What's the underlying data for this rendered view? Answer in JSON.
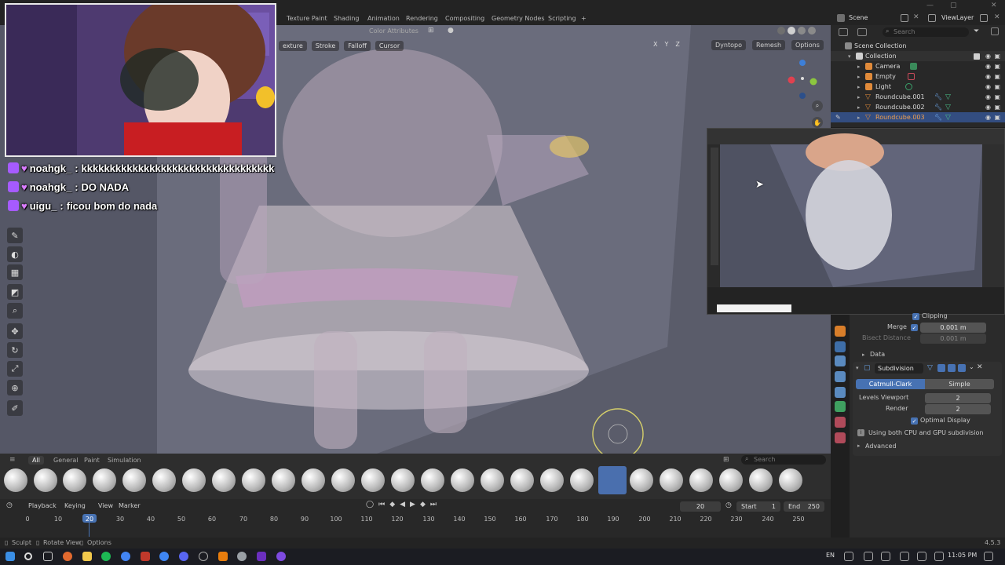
{
  "topbar": {
    "tabs": [
      "Texture Paint",
      "Shading",
      "Animation",
      "Rendering",
      "Compositing",
      "Geometry Nodes",
      "Scripting",
      "+"
    ],
    "scene_label": "Scene",
    "viewlayer_label": "ViewLayer"
  },
  "viewport": {
    "header_left": [
      "exture",
      "Stroke",
      "Falloff",
      "Cursor"
    ],
    "color_attributes": "Color Attributes",
    "axes": [
      "X",
      "Y",
      "Z"
    ],
    "dyntopo": "Dyntopo",
    "remesh": "Remesh",
    "options": "Options"
  },
  "chat": [
    {
      "user": "noahgk_",
      "message": "kkkkkkkkkkkkkkkkkkkkkkkkkkkkkkkkkk",
      "icon": "heart-icon"
    },
    {
      "user": "noahgk_",
      "message": "DO NADA",
      "icon": "heart-icon"
    },
    {
      "user": "uigu_",
      "message": "ficou bom do nada",
      "icon": "heart-icon"
    }
  ],
  "outliner": {
    "search_placeholder": "Search",
    "scene_collection": "Scene Collection",
    "items": [
      {
        "name": "Collection",
        "indent": 1
      },
      {
        "name": "Camera",
        "indent": 2
      },
      {
        "name": "Empty",
        "indent": 2
      },
      {
        "name": "Light",
        "indent": 2
      },
      {
        "name": "Roundcube.001",
        "indent": 2
      },
      {
        "name": "Roundcube.002",
        "indent": 2
      },
      {
        "name": "Roundcube.003",
        "indent": 2,
        "selected": true
      }
    ]
  },
  "properties": {
    "clipping": "Clipping",
    "merge_label": "Merge",
    "merge_value": "0.001 m",
    "bisect_label": "Bisect Distance",
    "bisect_value": "0.001 m",
    "data_label": "Data",
    "modifier_name": "Subdivision",
    "mode_catmull": "Catmull-Clark",
    "mode_simple": "Simple",
    "levels_viewport_label": "Levels Viewport",
    "levels_viewport_value": "2",
    "render_label": "Render",
    "render_value": "2",
    "optimal_display": "Optimal Display",
    "gpu_note": "Using both CPU and GPU subdivision",
    "advanced": "Advanced"
  },
  "brush_shelf": {
    "tabs": [
      "All",
      "General",
      "Paint",
      "Simulation"
    ],
    "search_placeholder": "Search"
  },
  "timeline": {
    "menus": [
      "Playback",
      "Keying",
      "View",
      "Marker"
    ],
    "current_frame": "20",
    "start_label": "Start",
    "start_value": "1",
    "end_label": "End",
    "end_value": "250",
    "ticks": [
      "0",
      "10",
      "20",
      "30",
      "40",
      "50",
      "60",
      "70",
      "80",
      "90",
      "100",
      "110",
      "120",
      "130",
      "140",
      "150",
      "160",
      "170",
      "180",
      "190",
      "200",
      "210",
      "220",
      "230",
      "240",
      "250"
    ]
  },
  "statusbar": {
    "sculpt": "Sculpt",
    "rotate_view": "Rotate View",
    "options": "Options",
    "version": "4.5.3"
  },
  "taskbar": {
    "lang": "EN",
    "time": "11:05 PM"
  }
}
